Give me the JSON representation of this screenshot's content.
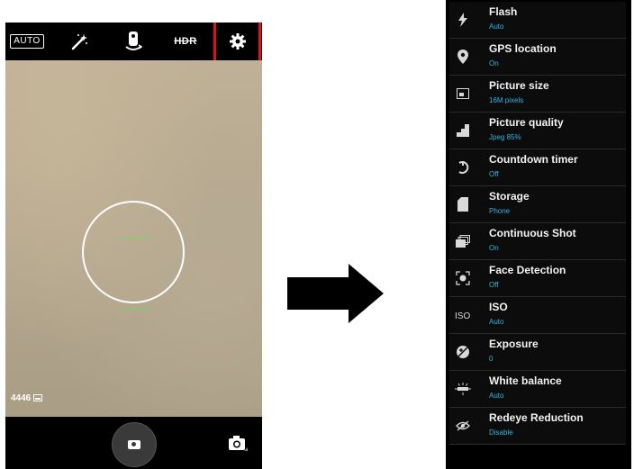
{
  "camera": {
    "topbar": {
      "auto_label": "AUTO",
      "hdr_label": "HDR"
    },
    "shots_remaining": "4446",
    "colors": {
      "focus_marks": "#33ff33",
      "highlight": "#e01212"
    }
  },
  "settings": {
    "accent_color": "#33b5e5",
    "items": [
      {
        "label": "Flash",
        "value": "Auto",
        "icon": "flash-icon"
      },
      {
        "label": "GPS location",
        "value": "On",
        "icon": "location-pin-icon"
      },
      {
        "label": "Picture size",
        "value": "16M pixels",
        "icon": "picture-size-icon"
      },
      {
        "label": "Picture quality",
        "value": "Jpeg 85%",
        "icon": "quality-bars-icon"
      },
      {
        "label": "Countdown timer",
        "value": "Off",
        "icon": "timer-icon"
      },
      {
        "label": "Storage",
        "value": "Phone",
        "icon": "sd-card-icon"
      },
      {
        "label": "Continuous Shot",
        "value": "On",
        "icon": "continuous-shot-icon"
      },
      {
        "label": "Face Detection",
        "value": "Off",
        "icon": "face-detection-icon"
      },
      {
        "label": "ISO",
        "value": "Auto",
        "icon": "iso-icon"
      },
      {
        "label": "Exposure",
        "value": "0",
        "icon": "exposure-icon"
      },
      {
        "label": "White balance",
        "value": "Auto",
        "icon": "white-balance-icon"
      },
      {
        "label": "Redeye Reduction",
        "value": "Disable",
        "icon": "redeye-icon"
      }
    ]
  }
}
